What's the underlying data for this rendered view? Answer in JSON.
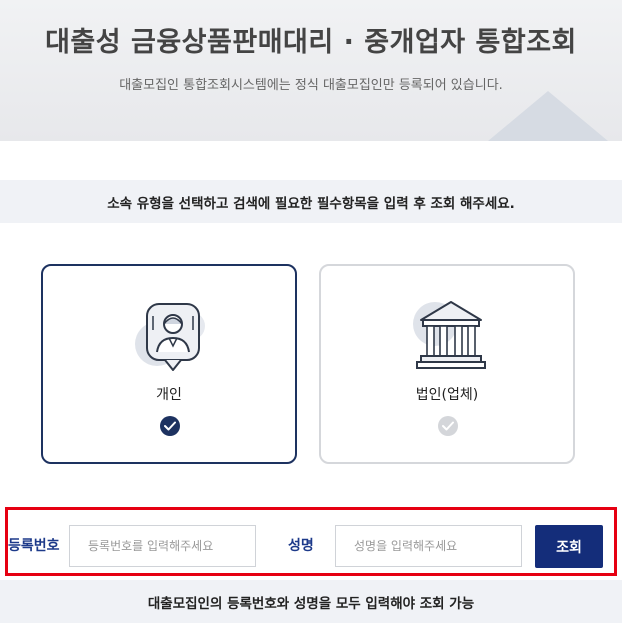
{
  "hero": {
    "title": "대출성 금융상품판매대리 · 중개업자 통합조회",
    "subtitle": "대출모집인 통합조회시스템에는 정식 대출모집인만 등록되어 있습니다."
  },
  "guide": {
    "text": "소속 유형을 선택하고 검색에 필요한 필수항목을 입력 후 조회 해주세요."
  },
  "types": [
    {
      "label": "개인",
      "selected": true,
      "icon": "person-icon"
    },
    {
      "label": "법인(업체)",
      "selected": false,
      "icon": "building-icon"
    }
  ],
  "search": {
    "reg_label": "등록번호",
    "reg_placeholder": "등록번호를 입력해주세요",
    "reg_value": "",
    "name_label": "성명",
    "name_placeholder": "성명을 입력해주세요",
    "name_value": "",
    "button_label": "조회"
  },
  "notice": {
    "text": "대출모집인의 등록번호와 성명을 모두 입력해야 조회 가능"
  },
  "colors": {
    "accent": "#1d3260",
    "button": "#142d7a",
    "label": "#1d3a8a",
    "highlight_border": "#e60012"
  }
}
